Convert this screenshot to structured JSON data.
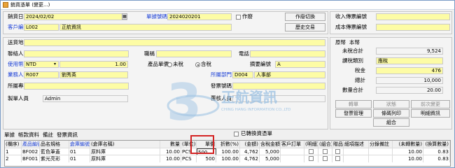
{
  "window": {
    "title": "銷貨憑單 (變更...)"
  },
  "header": {
    "sale_date_label": "銷貨日期",
    "sale_date": "2024/02/02",
    "doc_no_label": "單據號碼",
    "doc_no": "2024020201",
    "void_label": "作廢",
    "void_switch_btn": "作廢切換",
    "customer_label": "客戶編號",
    "customer_code": "L002",
    "customer_name": "正航資訊",
    "history_btn": "歷史交易",
    "ship_addr_label": "送貨地址",
    "contact_label": "聯絡人員",
    "title_label": "職稱",
    "phone_label": "電話",
    "currency_label": "使用幣別",
    "currency": "NTD",
    "rate": "1.00",
    "price_label": "產品單價",
    "price_opt1": "未稅",
    "price_opt2": "含稅",
    "summary_label": "摘要編號",
    "summary_value": "A",
    "sales_label": "業務人員",
    "sales_code": "R007",
    "sales_name": "劉秀英",
    "dept_label": "所屬部門",
    "dept_code": "D004",
    "dept_name": "人事部",
    "project_label": "所屬專案",
    "invoice_label": "發票號碼",
    "maker_label": "製單人員",
    "maker": "Admin",
    "reviewer_label": "覆核人員"
  },
  "right": {
    "receipt_label": "收入傳票編號",
    "cost_label": "成本傳票編號",
    "currency_hdr": "原幣",
    "local_hdr": "本幣",
    "untaxed_label": "未稅合計",
    "untaxed": "9,524",
    "tax_type_label": "課稅類別",
    "tax_type": "應稅",
    "tax_label": "稅金",
    "tax": "476",
    "total_label": "總計",
    "total": "10,000",
    "qty_total_label": "數量合計",
    "qty_total": "20.00",
    "btn_excerpt": "轉單",
    "btn_status": "狀態",
    "btn_history": "前次變更",
    "btn_invoice": "發票管理",
    "btn_print": "條碼列印",
    "btn_detail": "明細資訊",
    "btn_combo": "組合"
  },
  "tabs": [
    "單據",
    "帳款資料",
    "備註",
    "發票資訊"
  ],
  "selected_check_label": "已轉換資憑單",
  "grid": {
    "headers": [
      "(欄序)",
      "產品編號",
      "品名規格",
      "倉庫編號",
      "(倉庫名稱)",
      "數量",
      "(單位)",
      "單價",
      "折數(%)",
      "(金額)",
      "含稅金額",
      "客戶訂單",
      "(明細)",
      "(組合)",
      "贈品",
      "細項描述",
      "分錄備註",
      "(未轉數量)",
      "(換算數量)"
    ],
    "rows": [
      [
        "1",
        "BF002",
        "藍色筆蓋",
        "01",
        "原料庫",
        "10.00",
        "PCS",
        "500",
        "100.00",
        "4,762",
        "5,000",
        "",
        "",
        "",
        "",
        "",
        "",
        "10.00",
        "0.83"
      ],
      [
        "2",
        "BF001",
        "紫光亮彩",
        "01",
        "原料庫",
        "10.00",
        "PCS",
        "500",
        "100.00",
        "4,762",
        "5,000",
        "",
        "",
        "",
        "",
        "",
        "",
        "10.00",
        "0.83"
      ]
    ]
  },
  "watermark": {
    "text": "正航資訊",
    "sub": "CHING HANG INFORMATION CO.,LTD"
  }
}
